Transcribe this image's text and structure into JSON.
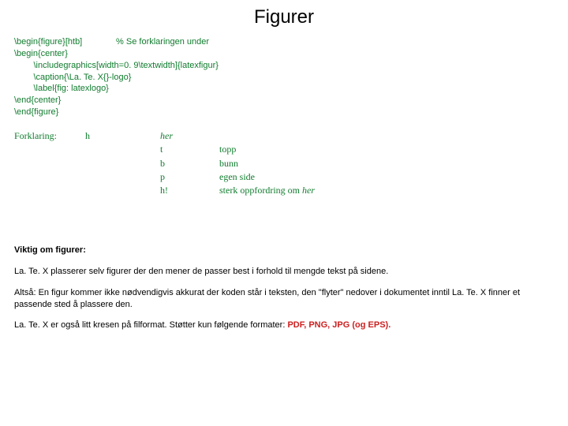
{
  "title": "Figurer",
  "code": {
    "l1a": "\\begin{figure}[htb]",
    "l1b": "% Se forklaringen under",
    "l2": "\\begin{center}",
    "l3": "        \\includegraphics[width=0. 9\\textwidth]{latexfigur}",
    "l4": "        \\caption{\\La. Te. X{}-logo}",
    "l5": "        \\label{fig: latexlogo}",
    "l6": "\\end{center}",
    "l7": "\\end{figure}"
  },
  "explain": {
    "label": "Forklaring:",
    "key": "h",
    "rows": [
      {
        "k": "her",
        "v": ""
      },
      {
        "k": "t",
        "v": "topp"
      },
      {
        "k": "b",
        "v": "bunn"
      },
      {
        "k": "p",
        "v": "egen side"
      },
      {
        "k": "h!",
        "v": "sterk oppfordring om "
      }
    ],
    "her_italic": "her"
  },
  "section_head": "Viktig om figurer:",
  "para1": "La. Te. X plasserer selv figurer der den mener de passer best i forhold til mengde tekst på sidene.",
  "para2": "Altså: En figur kommer ikke nødvendigvis akkurat der koden står i teksten, den \"flyter\" nedover i dokumentet inntil La. Te. X finner et passende sted å plassere den.",
  "para3a": "La. Te. X er også litt kresen på filformat. Støtter kun følgende formater: ",
  "para3b": "PDF, PNG, JPG (og EPS)."
}
